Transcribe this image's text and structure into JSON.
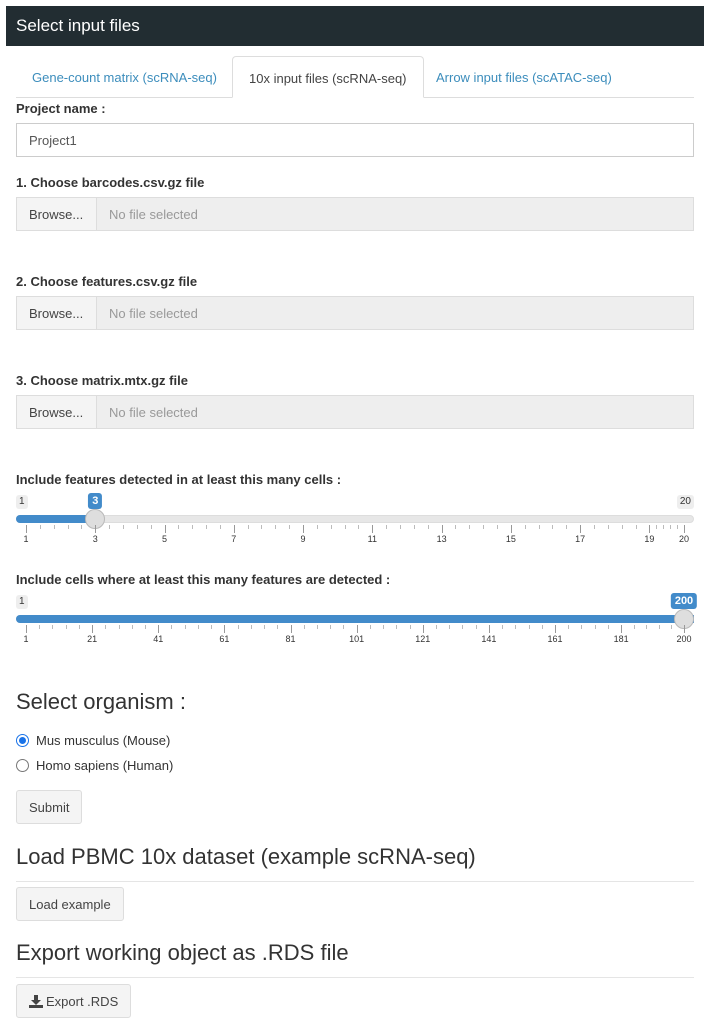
{
  "header": {
    "title": "Select input files"
  },
  "tabs": [
    {
      "label": "Gene-count matrix (scRNA-seq)"
    },
    {
      "label": "10x input files (scRNA-seq)"
    },
    {
      "label": "Arrow input files (scATAC-seq)"
    }
  ],
  "project": {
    "label": "Project name :",
    "value": "Project1"
  },
  "files": [
    {
      "label": "1. Choose barcodes.csv.gz file",
      "button": "Browse...",
      "status": "No file selected"
    },
    {
      "label": "2. Choose features.csv.gz file",
      "button": "Browse...",
      "status": "No file selected"
    },
    {
      "label": "3. Choose matrix.mtx.gz file",
      "button": "Browse...",
      "status": "No file selected"
    }
  ],
  "slider1": {
    "label": "Include features detected in at least this many cells :",
    "min": 1,
    "max": 20,
    "value": 3,
    "min_label": "1",
    "max_label": "20",
    "value_label": "3",
    "ticks": [
      "1",
      "3",
      "5",
      "7",
      "9",
      "11",
      "13",
      "15",
      "17",
      "19",
      "20"
    ]
  },
  "slider2": {
    "label": "Include cells where at least this many features are detected :",
    "min": 1,
    "max": 200,
    "value": 200,
    "min_label": "1",
    "value_label": "200",
    "ticks": [
      "1",
      "21",
      "41",
      "61",
      "81",
      "101",
      "121",
      "141",
      "161",
      "181",
      "200"
    ]
  },
  "organism": {
    "heading": "Select organism :",
    "options": [
      {
        "label": "Mus musculus (Mouse)",
        "checked": true
      },
      {
        "label": "Homo sapiens (Human)",
        "checked": false
      }
    ],
    "submit": "Submit"
  },
  "example": {
    "heading": "Load PBMC 10x dataset (example scRNA-seq)",
    "button": "Load example"
  },
  "export": {
    "heading": "Export working object as .RDS file",
    "button": "Export .RDS",
    "icon": "download-icon"
  },
  "colors": {
    "header_bg": "#222d32",
    "accent": "#3c8dbc",
    "slider": "#428bca"
  }
}
